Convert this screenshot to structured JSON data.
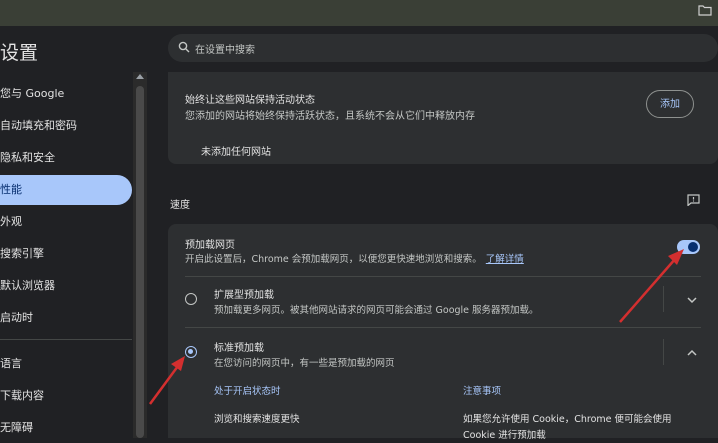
{
  "header": {
    "title": "设置"
  },
  "search": {
    "placeholder": "在设置中搜索"
  },
  "sidebar": {
    "items": [
      {
        "label": "您与 Google"
      },
      {
        "label": "自动填充和密码"
      },
      {
        "label": "隐私和安全"
      },
      {
        "label": "性能"
      },
      {
        "label": "外观"
      },
      {
        "label": "搜索引擎"
      },
      {
        "label": "默认浏览器"
      },
      {
        "label": "启动时"
      },
      {
        "label": "语言"
      },
      {
        "label": "下载内容"
      },
      {
        "label": "无障碍"
      }
    ],
    "active_index": 3
  },
  "keep_active": {
    "title": "始终让这些网站保持活动状态",
    "description": "您添加的网站将始终保持活跃状态，且系统不会从它们中释放内存",
    "add_label": "添加",
    "empty_text": "未添加任何网站"
  },
  "speed": {
    "section_label": "速度",
    "preload": {
      "title": "预加载网页",
      "description": "开启此设置后，Chrome 会预加载网页，以便您更快速地浏览和搜索。",
      "link": "了解详情",
      "enabled": true
    },
    "options": [
      {
        "title": "扩展型预加载",
        "description": "预加载更多网页。被其他网站请求的网页可能会通过 Google 服务器预加载。",
        "selected": false
      },
      {
        "title": "标准预加载",
        "description": "在您访问的网页中，有一些是预加载的网页",
        "selected": true
      }
    ],
    "details": {
      "left_heading": "处于开启状态时",
      "left_text": "浏览和搜索速度更快",
      "right_heading": "注意事项",
      "right_text_1": "如果您允许使用 Cookie，Chrome 便可能会使用",
      "right_text_2": "Cookie 进行预加载"
    }
  },
  "colors": {
    "accent": "#a8c7fa",
    "background": "#202124",
    "card": "#2d2f31",
    "annotation": "#d32f2f"
  }
}
